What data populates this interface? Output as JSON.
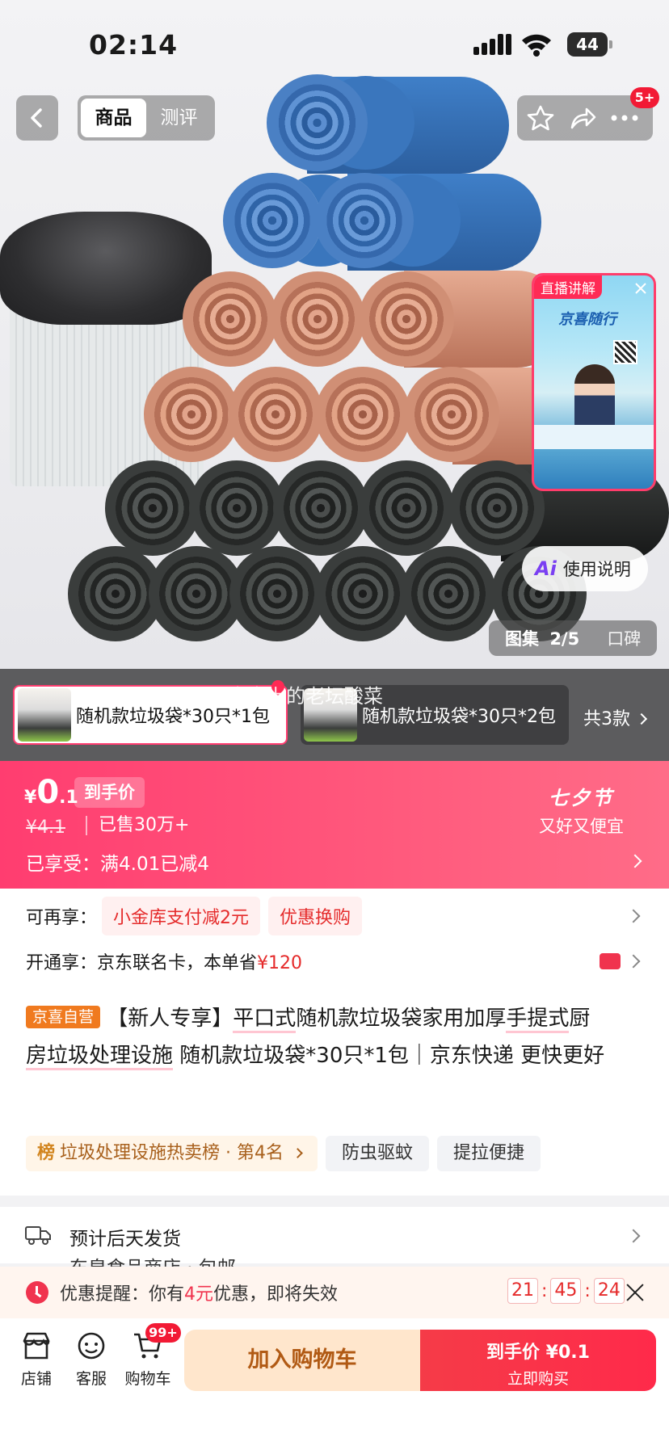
{
  "status_bar": {
    "time": "02:14",
    "battery": "44"
  },
  "header": {
    "tabs": [
      {
        "label": "商品"
      },
      {
        "label": "测评"
      }
    ],
    "notification_badge": "5+"
  },
  "hero": {
    "live_tag": "直播讲解",
    "live_banner": "京喜随行",
    "ai_help": "使用说明",
    "gallery_label": "图集",
    "gallery_counter": "2/5",
    "reviews_label": "口碑"
  },
  "variants": {
    "overlay_text": "脚尖上的老坛酸菜",
    "items": [
      {
        "label": "随机款垃圾袋*30只*1包",
        "selected": true
      },
      {
        "label": "随机款垃圾袋*30只*2包",
        "selected": false
      }
    ],
    "total_label": "共3款"
  },
  "price": {
    "currency": "¥",
    "integer": "0",
    "decimal": ".1",
    "tag": "到手价",
    "original": "¥4.1",
    "sold": "已售30万+",
    "enjoyed": "已享受：满4.01已减4",
    "festival_title": "七夕节",
    "festival_sub": "又好又便宜"
  },
  "offers": {
    "label": "可再享：",
    "pills": [
      "小金库支付减2元",
      "优惠换购"
    ],
    "membership_prefix": "开通享：京东联名卡，本单省",
    "membership_amount": "¥120"
  },
  "product": {
    "seller_tag": "京喜自营",
    "title_prefix": "【新人专享】",
    "title_underlined_1": "平口式",
    "title_mid_1": "随机款垃圾袋家用加厚",
    "title_underlined_2": "手提式",
    "title_mid_2": "厨",
    "title_line2_underlined": "房垃圾处理设施",
    "title_rest": " 随机款垃圾袋*30只*1包｜京东快递 更快更好"
  },
  "tags": {
    "rank_icon": "榜",
    "rank": "垃圾处理设施热卖榜 · 第4名",
    "items": [
      "防虫驱蚊",
      "提拉便捷"
    ]
  },
  "shipping": {
    "line1": "预计后天发货",
    "line2": "东皇食品商店 · 包邮"
  },
  "reminder": {
    "prefix": "优惠提醒：你有",
    "amount": "4元",
    "suffix": "优惠，即将失效",
    "hours": "21",
    "minutes": "45",
    "seconds": "24"
  },
  "bottom_bar": {
    "store": "店铺",
    "service": "客服",
    "cart": "购物车",
    "cart_badge": "99+",
    "add_to_cart": "加入购物车",
    "buy_line1": "到手价 ¥0.1",
    "buy_line2": "立即购买"
  },
  "colors": {
    "accent": "#ff3d70",
    "buy": "#f53b48",
    "cart_btn": "#ffe6cc"
  }
}
